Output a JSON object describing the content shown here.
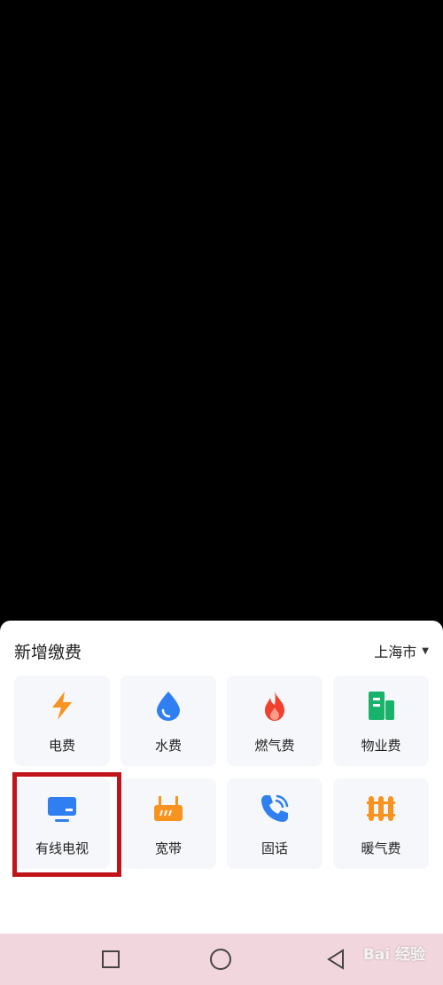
{
  "sheet": {
    "title": "新增缴费",
    "city": "上海市"
  },
  "tiles": [
    {
      "label": "电费",
      "icon": "lightning-icon",
      "color": "#f7931e"
    },
    {
      "label": "水费",
      "icon": "water-drop-icon",
      "color": "#2f7ff0"
    },
    {
      "label": "燃气费",
      "icon": "flame-icon",
      "color": "#f0412f"
    },
    {
      "label": "物业费",
      "icon": "building-icon",
      "color": "#18b26b"
    },
    {
      "label": "有线电视",
      "icon": "tv-icon",
      "color": "#2f7ff0"
    },
    {
      "label": "宽带",
      "icon": "router-icon",
      "color": "#f7931e"
    },
    {
      "label": "固话",
      "icon": "phone-icon",
      "color": "#2f7ff0"
    },
    {
      "label": "暖气费",
      "icon": "radiator-icon",
      "color": "#f7931e"
    }
  ],
  "watermark": "Bai 经验"
}
